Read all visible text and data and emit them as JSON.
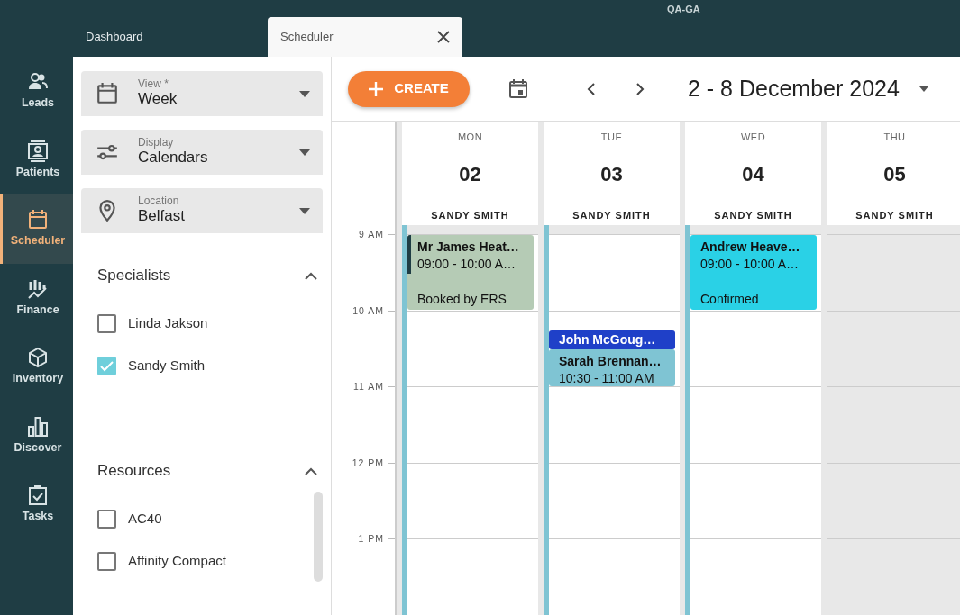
{
  "environment": "QA-GA",
  "tabs": [
    {
      "label": "Dashboard",
      "selected": false,
      "closable": false
    },
    {
      "label": "Scheduler",
      "selected": true,
      "closable": true
    }
  ],
  "nav": [
    {
      "label": "Leads",
      "selected": false
    },
    {
      "label": "Patients",
      "selected": false
    },
    {
      "label": "Scheduler",
      "selected": true
    },
    {
      "label": "Finance",
      "selected": false
    },
    {
      "label": "Inventory",
      "selected": false
    },
    {
      "label": "Discover",
      "selected": false
    },
    {
      "label": "Tasks",
      "selected": false
    }
  ],
  "filters": [
    {
      "label": "View *",
      "value": "Week"
    },
    {
      "label": "Display",
      "value": "Calendars"
    },
    {
      "label": "Location",
      "value": "Belfast"
    }
  ],
  "sections": [
    {
      "title": "Specialists",
      "expanded": true,
      "items": [
        {
          "label": "Linda Jakson",
          "checked": false
        },
        {
          "label": "Sandy Smith",
          "checked": true
        }
      ]
    },
    {
      "title": "Resources",
      "expanded": true,
      "items": [
        {
          "label": "AC40",
          "checked": false
        },
        {
          "label": "Affinity Compact",
          "checked": false
        }
      ]
    }
  ],
  "toolbar": {
    "create": "CREATE",
    "range": "2 - 8 December 2024"
  },
  "time_labels": [
    "9 AM",
    "10 AM",
    "11 AM",
    "12 PM",
    "1 PM"
  ],
  "days": [
    {
      "weekday": "MON",
      "date": "02",
      "person": "SANDY SMITH",
      "available": true,
      "hours": [
        {
          "kind": "booked",
          "events": [
            {
              "kind": "full",
              "title": "Mr James Heat…",
              "time": "09:00 - 10:00 A…",
              "status": "Booked by ERS",
              "color": "#b5cbb5",
              "accent": true
            }
          ]
        }
      ]
    },
    {
      "weekday": "TUE",
      "date": "03",
      "person": "SANDY SMITH",
      "available": true,
      "hours": [
        {
          "kind": "free"
        },
        {
          "kind": "booked",
          "events": [
            {
              "kind": "quarter",
              "title": "John McGoug…",
              "color": "#1f40c8",
              "accent": false
            },
            {
              "kind": "half",
              "title": "Sarah Brennan…",
              "time": "10:30 - 11:00 AM",
              "color": "#7fc4d3",
              "accent": false
            }
          ]
        }
      ]
    },
    {
      "weekday": "WED",
      "date": "04",
      "person": "SANDY SMITH",
      "available": true,
      "hours": [
        {
          "kind": "booked",
          "events": [
            {
              "kind": "full",
              "title": "Andrew Heave…",
              "time": "09:00 - 10:00 A…",
              "status": "Confirmed",
              "color": "#2ad1e6",
              "accent": false
            }
          ]
        }
      ]
    },
    {
      "weekday": "THU",
      "date": "05",
      "person": "SANDY SMITH",
      "available": false
    }
  ]
}
